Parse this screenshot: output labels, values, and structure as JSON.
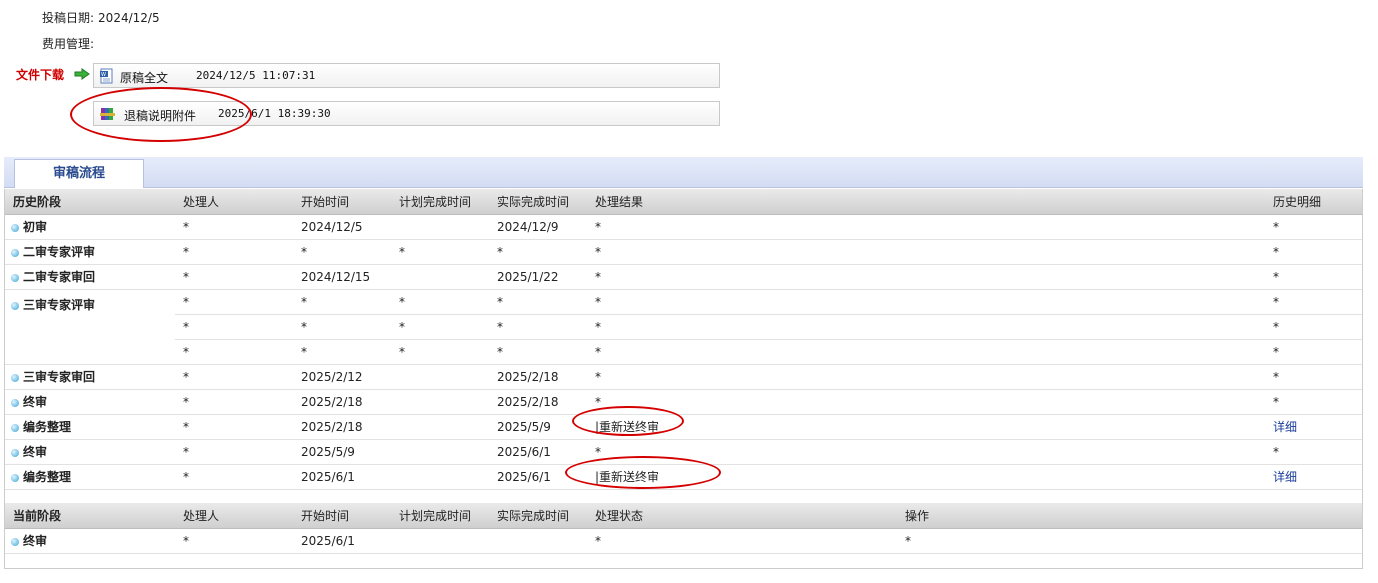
{
  "info": {
    "submit_date_label": "投稿日期:",
    "submit_date": "2024/12/5",
    "fee_label": "费用管理:"
  },
  "downloads": {
    "label": "文件下载",
    "arrow_icon": "green-arrow-icon",
    "files": [
      {
        "name": "原稿全文",
        "time": "2024/12/5 11:07:31",
        "icon": "word-document-icon"
      },
      {
        "name": "退稿说明附件",
        "time": "2025/6/1 18:39:30",
        "icon": "archive-books-icon"
      }
    ]
  },
  "tabs": [
    {
      "label": "审稿流程"
    }
  ],
  "history": {
    "headers": [
      "历史阶段",
      "处理人",
      "开始时间",
      "计划完成时间",
      "实际完成时间",
      "处理结果",
      "历史明细"
    ],
    "rows": [
      {
        "stage": "初审",
        "handler": "*",
        "start": "2024/12/5",
        "plan": "",
        "actual": "2024/12/9",
        "result": "*",
        "detail": "*"
      },
      {
        "stage": "二审专家评审",
        "handler": "*",
        "start": "*",
        "plan": "*",
        "actual": "*",
        "result": "*",
        "detail": "*"
      },
      {
        "stage": "二审专家审回",
        "handler": "*",
        "start": "2024/12/15",
        "plan": "",
        "actual": "2025/1/22",
        "result": "*",
        "detail": "*"
      },
      {
        "stage": "三审专家评审",
        "handler": "*",
        "start": "*",
        "plan": "*",
        "actual": "*",
        "result": "*",
        "detail": "*"
      },
      {
        "stage": "",
        "handler": "*",
        "start": "*",
        "plan": "*",
        "actual": "*",
        "result": "*",
        "detail": "*"
      },
      {
        "stage": "",
        "handler": "*",
        "start": "*",
        "plan": "*",
        "actual": "*",
        "result": "*",
        "detail": "*"
      },
      {
        "stage": "三审专家审回",
        "handler": "*",
        "start": "2025/2/12",
        "plan": "",
        "actual": "2025/2/18",
        "result": "*",
        "detail": "*"
      },
      {
        "stage": "终审",
        "handler": "*",
        "start": "2025/2/18",
        "plan": "",
        "actual": "2025/2/18",
        "result": "*",
        "detail": "*"
      },
      {
        "stage": "编务整理",
        "handler": "*",
        "start": "2025/2/18",
        "plan": "",
        "actual": "2025/5/9",
        "result": "|重新送终审",
        "detail": "详细"
      },
      {
        "stage": "终审",
        "handler": "*",
        "start": "2025/5/9",
        "plan": "",
        "actual": "2025/6/1",
        "result": "*",
        "detail": "*"
      },
      {
        "stage": "编务整理",
        "handler": "*",
        "start": "2025/6/1",
        "plan": "",
        "actual": "2025/6/1",
        "result": "|重新送终审",
        "detail": "详细"
      }
    ]
  },
  "current": {
    "headers": [
      "当前阶段",
      "处理人",
      "开始时间",
      "计划完成时间",
      "实际完成时间",
      "处理状态",
      "操作"
    ],
    "rows": [
      {
        "stage": "终审",
        "handler": "*",
        "start": "2025/6/1",
        "plan": "",
        "actual": "",
        "status": "*",
        "op": "*"
      }
    ]
  },
  "colors": {
    "highlight_ellipse": "#d40000",
    "link": "#1a3b9c",
    "download_label": "#d10000"
  }
}
